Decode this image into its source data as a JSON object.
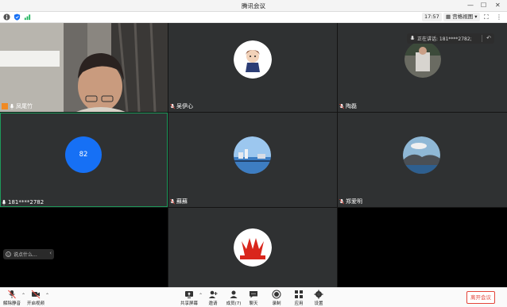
{
  "window": {
    "title": "腾讯会议"
  },
  "toolbar": {
    "timer": "17:57",
    "view_label": "宫格视图"
  },
  "participants": [
    {
      "name": "凤尾竹"
    },
    {
      "name": "吴伊心"
    },
    {
      "name": "陶磊"
    },
    {
      "name": "181****2782",
      "avatar_text": "82"
    },
    {
      "name": "蘇蘇"
    },
    {
      "name": "郑爱明"
    }
  ],
  "speaking": {
    "label": "正在讲话: 181****2782;"
  },
  "chat": {
    "placeholder": "说点什么..."
  },
  "controls": {
    "unmute": "解除静音",
    "start_video": "开启视频",
    "share_screen": "共享屏幕",
    "invite": "邀请",
    "members": "成员(7)",
    "chat": "聊天",
    "record": "录制",
    "apps": "应用",
    "settings": "设置",
    "leave": "离开会议"
  },
  "colors": {
    "accent": "#1670f5",
    "leave": "#e4453a",
    "active_border": "#1d9a5b"
  }
}
